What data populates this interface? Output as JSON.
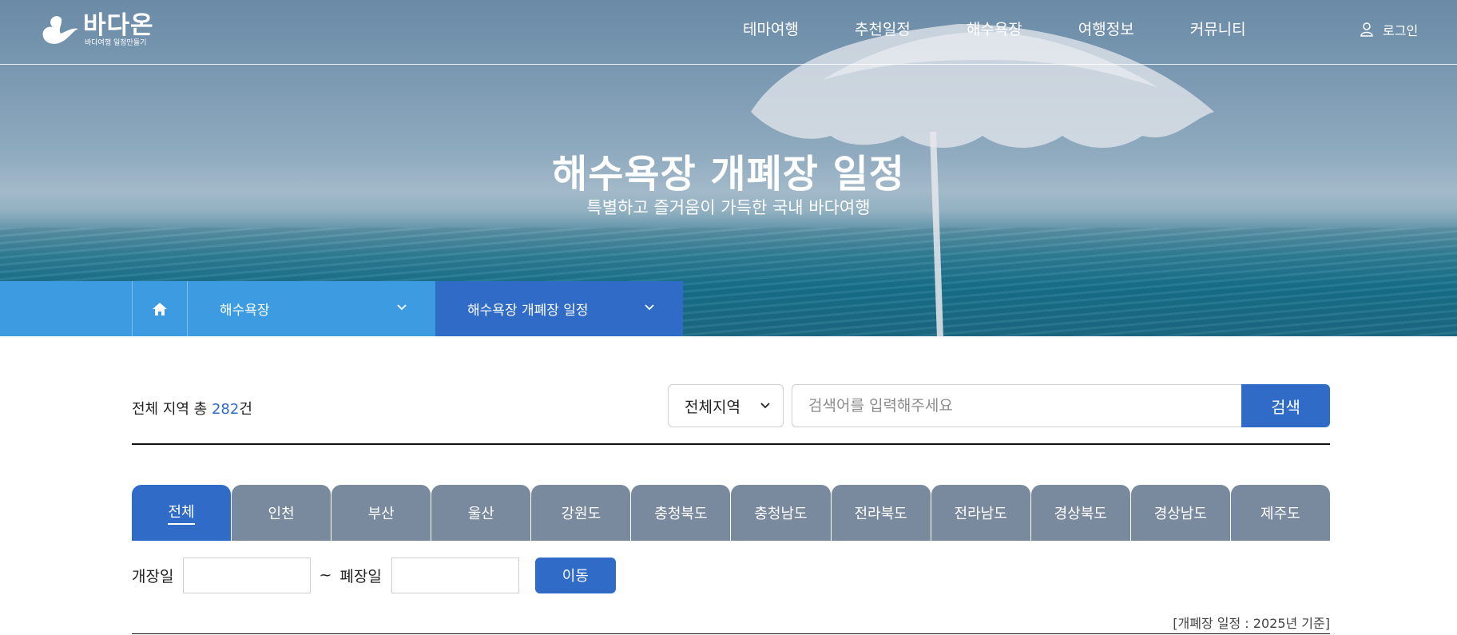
{
  "header": {
    "logo_title": "바다온",
    "logo_sub": "바다여행 일정만들기",
    "nav": [
      "테마여행",
      "추천일정",
      "해수욕장",
      "여행정보",
      "커뮤니티"
    ],
    "login_label": "로그인"
  },
  "hero": {
    "title": "해수욕장 개폐장 일정",
    "subtitle": "특별하고 즐거움이 가득한 국내 바다여행"
  },
  "breadcrumb": {
    "home_icon": "home-icon",
    "level1": "해수욕장",
    "level2": "해수욕장 개폐장 일정"
  },
  "search": {
    "count_prefix": "전체 지역 총 ",
    "count_value": "282",
    "count_suffix": "건",
    "region_selected": "전체지역",
    "placeholder": "검색어를 입력해주세요",
    "button_label": "검색"
  },
  "tabs": [
    "전체",
    "인천",
    "부산",
    "울산",
    "강원도",
    "충청북도",
    "충청남도",
    "전라북도",
    "전라남도",
    "경상북도",
    "경상남도",
    "제주도"
  ],
  "active_tab": 0,
  "date_filter": {
    "open_label": "개장일",
    "tilde": "~",
    "close_label": "폐장일",
    "open_value": "",
    "close_value": "",
    "move_label": "이동"
  },
  "note": "[개폐장 일정 : 2025년 기준]",
  "colors": {
    "primary": "#2f6bc7",
    "breadcrumb": "#3d9be2",
    "tab_inactive": "#7a8a9e"
  }
}
